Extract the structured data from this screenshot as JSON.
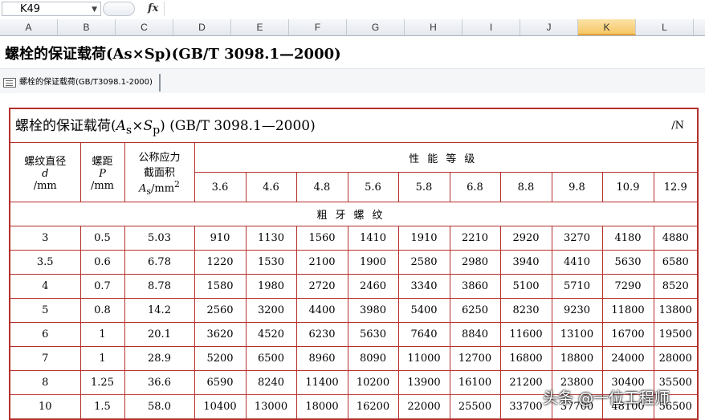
{
  "formula_bar": {
    "cell_ref": "K49",
    "fx": "fx",
    "formula": ""
  },
  "columns": [
    "A",
    "B",
    "C",
    "D",
    "E",
    "F",
    "G",
    "H",
    "I",
    "J",
    "K",
    "L"
  ],
  "selected_column": "K",
  "sheet_title": "螺栓的保证载荷(As×Sp)(GB/T 3098.1—2000)",
  "tab_label": "螺栓的保证载荷(GB/T3098.1-2000)",
  "table": {
    "caption_prefix": "螺栓的保证载荷(",
    "caption_A": "A",
    "caption_s": "s",
    "caption_times": "×",
    "caption_S": "S",
    "caption_p": "p",
    "caption_suffix": ") (GB/T 3098.1—2000)",
    "unit": "/N",
    "col1": [
      "螺纹直径",
      "d",
      "/mm"
    ],
    "col2": [
      "螺距",
      "P",
      "/mm"
    ],
    "col3": [
      "公称应力",
      "截面积",
      "A",
      "s",
      "/mm",
      "2"
    ],
    "grade_header": "性能等级",
    "grades": [
      "3.6",
      "4.6",
      "4.8",
      "5.6",
      "5.8",
      "6.8",
      "8.8",
      "9.8",
      "10.9",
      "12.9"
    ],
    "group_label": "粗牙螺纹",
    "rows": [
      [
        "3",
        "0.5",
        "5.03",
        "910",
        "1130",
        "1560",
        "1410",
        "1910",
        "2210",
        "2920",
        "3270",
        "4180",
        "4880"
      ],
      [
        "3.5",
        "0.6",
        "6.78",
        "1220",
        "1530",
        "2100",
        "1900",
        "2580",
        "2980",
        "3940",
        "4410",
        "5630",
        "6580"
      ],
      [
        "4",
        "0.7",
        "8.78",
        "1580",
        "1980",
        "2720",
        "2460",
        "3340",
        "3860",
        "5100",
        "5710",
        "7290",
        "8520"
      ],
      [
        "5",
        "0.8",
        "14.2",
        "2560",
        "3200",
        "4400",
        "3980",
        "5400",
        "6250",
        "8230",
        "9230",
        "11800",
        "13800"
      ],
      [
        "6",
        "1",
        "20.1",
        "3620",
        "4520",
        "6230",
        "5630",
        "7640",
        "8840",
        "11600",
        "13100",
        "16700",
        "19500"
      ],
      [
        "7",
        "1",
        "28.9",
        "5200",
        "6500",
        "8960",
        "8090",
        "11000",
        "12700",
        "16800",
        "18800",
        "24000",
        "28000"
      ],
      [
        "8",
        "1.25",
        "36.6",
        "6590",
        "8240",
        "11400",
        "10200",
        "13900",
        "16100",
        "21200",
        "23800",
        "30400",
        "35500"
      ],
      [
        "10",
        "1.5",
        "58.0",
        "10400",
        "13000",
        "18000",
        "16200",
        "22000",
        "25500",
        "33700",
        "37700",
        "48100",
        "56500"
      ]
    ]
  },
  "watermark": "头条 @一位工程师"
}
